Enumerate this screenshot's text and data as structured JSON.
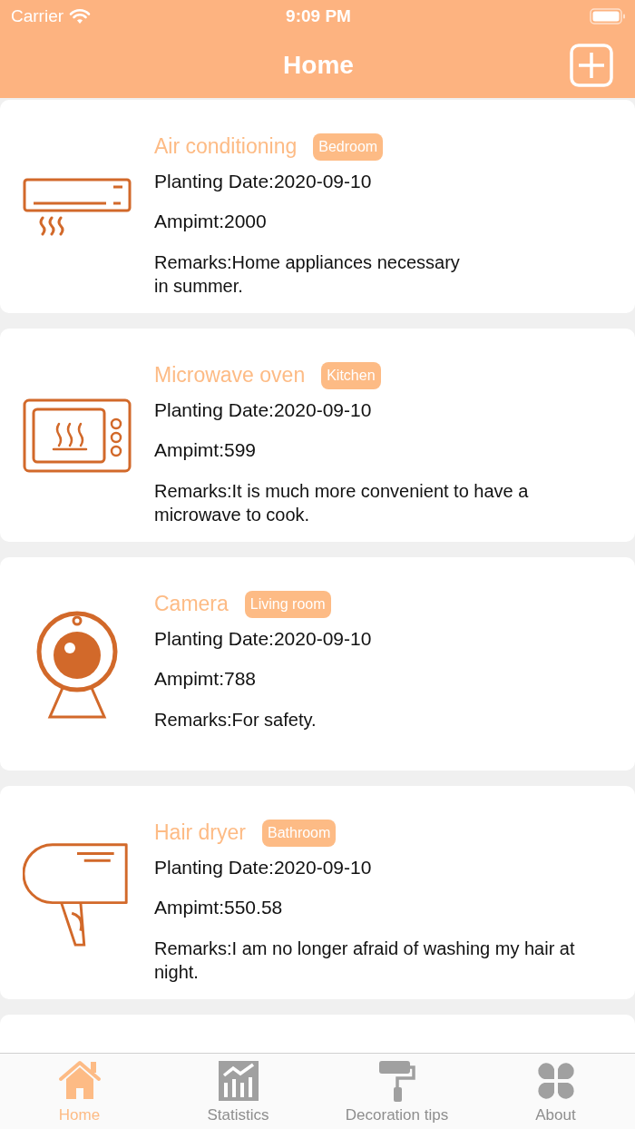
{
  "status_bar": {
    "carrier": "Carrier",
    "time": "9:09 PM"
  },
  "nav": {
    "title": "Home"
  },
  "items": [
    {
      "kind": "air_conditioner",
      "name": "Air conditioning",
      "room": "Bedroom",
      "date": "Planting Date:2020-09-10",
      "amount": "Ampimt:2000",
      "remarks": "Remarks:Home appliances necessary\nin summer."
    },
    {
      "kind": "microwave",
      "name": "Microwave oven",
      "room": "Kitchen",
      "date": "Planting Date:2020-09-10",
      "amount": "Ampimt:599",
      "remarks": "Remarks:It is much more convenient to have a microwave to cook."
    },
    {
      "kind": "camera",
      "name": "Camera",
      "room": "Living room",
      "date": "Planting Date:2020-09-10",
      "amount": "Ampimt:788",
      "remarks": "Remarks:For safety."
    },
    {
      "kind": "hair_dryer",
      "name": "Hair dryer",
      "room": "Bathroom",
      "date": "Planting Date:2020-09-10",
      "amount": "Ampimt:550.58",
      "remarks": "Remarks:I am no longer afraid of washing my hair at night."
    }
  ],
  "tabs": [
    {
      "kind": "home",
      "label": "Home",
      "selected": true
    },
    {
      "kind": "statistics",
      "label": "Statistics",
      "selected": false
    },
    {
      "kind": "roller",
      "label": "Decoration tips",
      "selected": false
    },
    {
      "kind": "clover",
      "label": "About",
      "selected": false
    }
  ]
}
